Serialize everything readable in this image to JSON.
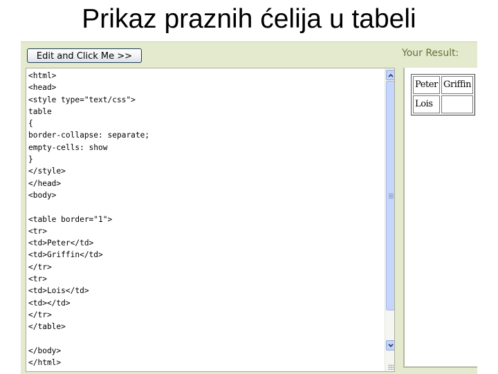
{
  "slide": {
    "title": "Prikaz praznih ćelija u tabeli"
  },
  "toolbar": {
    "submit_label": "Edit and Click Me >>",
    "result_label": "Your Result:"
  },
  "editor": {
    "code": "<html>\n<head>\n<style type=\"text/css\">\ntable\n{\nborder-collapse: separate;\nempty-cells: show\n}\n</style>\n</head>\n<body>\n\n<table border=\"1\">\n<tr>\n<td>Peter</td>\n<td>Griffin</td>\n</tr>\n<tr>\n<td>Lois</td>\n<td></td>\n</tr>\n</table>\n\n</body>\n</html>",
    "scrollbar": {
      "up_icon": "chevron-up-icon",
      "down_icon": "chevron-down-icon"
    }
  },
  "result": {
    "rows": [
      [
        "Peter",
        "Griffin"
      ],
      [
        "Lois",
        ""
      ]
    ]
  },
  "colors": {
    "panel_bg": "#e3eacd",
    "result_label": "#6b6d3a",
    "scrollbar": "#c4d3fb"
  }
}
